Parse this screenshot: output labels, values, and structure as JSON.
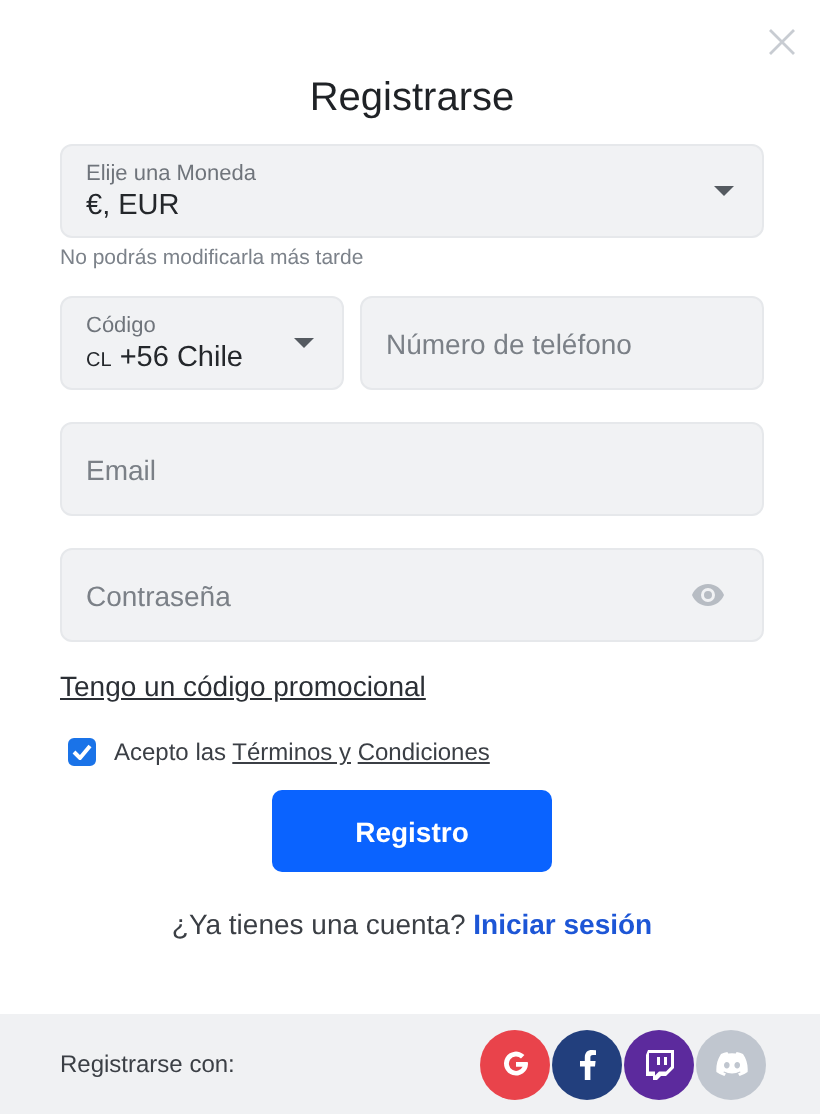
{
  "title": "Registrarse",
  "currency": {
    "label": "Elije una Moneda",
    "value": "€, EUR",
    "hint": "No podrás modificarla más tarde"
  },
  "code": {
    "label": "Código",
    "country": "CL",
    "value": "+56 Chile"
  },
  "phone": {
    "placeholder": "Número de teléfono"
  },
  "email": {
    "placeholder": "Email"
  },
  "password": {
    "placeholder": "Contraseña"
  },
  "promo_link": "Tengo un código promocional",
  "terms": {
    "checked": true,
    "prefix": "Acepto las ",
    "link_1": "Términos y",
    "link_2": "Condiciones"
  },
  "submit": "Registro",
  "login": {
    "question": "¿Ya tienes una cuenta?",
    "link": "Iniciar sesión"
  },
  "footer": {
    "label": "Registrarse con:",
    "providers": [
      {
        "kind": "google",
        "color": "#e9434b"
      },
      {
        "kind": "facebook",
        "color": "#223f7d"
      },
      {
        "kind": "twitch",
        "color": "#5c2a9d"
      },
      {
        "kind": "discord",
        "color": "#c0c6cf"
      }
    ]
  }
}
